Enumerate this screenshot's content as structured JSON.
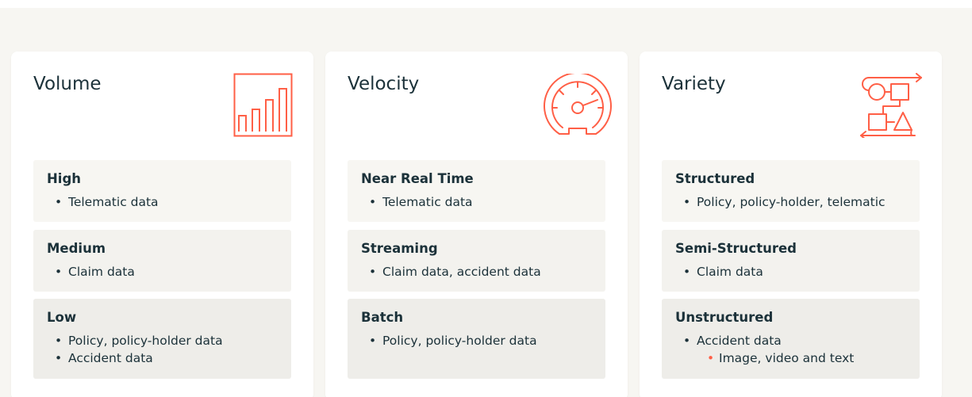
{
  "colors": {
    "accent": "#FF5F46",
    "text": "#1B3139",
    "background": "#F7F6F2"
  },
  "cards": [
    {
      "title": "Volume",
      "icon": "bar-chart-icon",
      "rows": [
        {
          "title": "High",
          "bullets": [
            "Telematic data"
          ]
        },
        {
          "title": "Medium",
          "bullets": [
            "Claim data"
          ]
        },
        {
          "title": "Low",
          "bullets": [
            "Policy, policy-holder data",
            "Accident data"
          ]
        }
      ]
    },
    {
      "title": "Velocity",
      "icon": "speedometer-icon",
      "rows": [
        {
          "title": "Near Real Time",
          "bullets": [
            "Telematic data"
          ]
        },
        {
          "title": "Streaming",
          "bullets": [
            "Claim data, accident data"
          ]
        },
        {
          "title": "Batch",
          "bullets": [
            "Policy, policy-holder data"
          ]
        }
      ]
    },
    {
      "title": "Variety",
      "icon": "shapes-flow-icon",
      "rows": [
        {
          "title": "Structured",
          "bullets": [
            "Policy, policy-holder, telematic"
          ]
        },
        {
          "title": "Semi-Structured",
          "bullets": [
            "Claim data"
          ]
        },
        {
          "title": "Unstructured",
          "bullets": [
            "Accident data"
          ],
          "sub_bullets": [
            "Image, video and text"
          ]
        }
      ]
    }
  ]
}
